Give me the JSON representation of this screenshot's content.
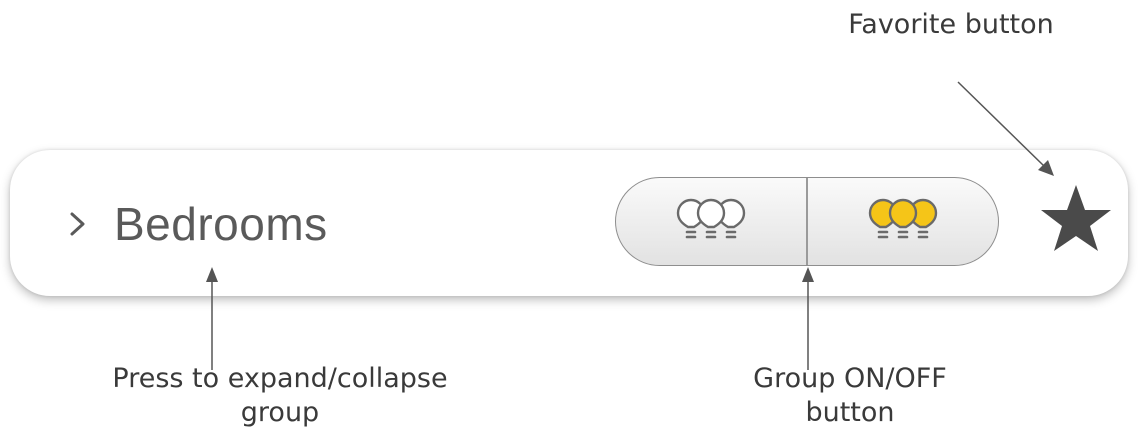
{
  "annotations": {
    "favorite": "Favorite button",
    "expand_line1": "Press to expand/collapse",
    "expand_line2": "group",
    "group_line1": "Group ON/OFF",
    "group_line2": "button"
  },
  "group": {
    "name": "Bedrooms",
    "chevron_icon": "chevron-right-icon",
    "off_icon": "bulb-group-off-icon",
    "on_icon": "bulb-group-on-icon",
    "favorite_icon": "star-icon"
  },
  "colors": {
    "text": "#5a5a5a",
    "bulb_on": "#f5c518",
    "bulb_off": "#ffffff",
    "star": "#4a4a4a",
    "annotation_line": "#555555"
  }
}
